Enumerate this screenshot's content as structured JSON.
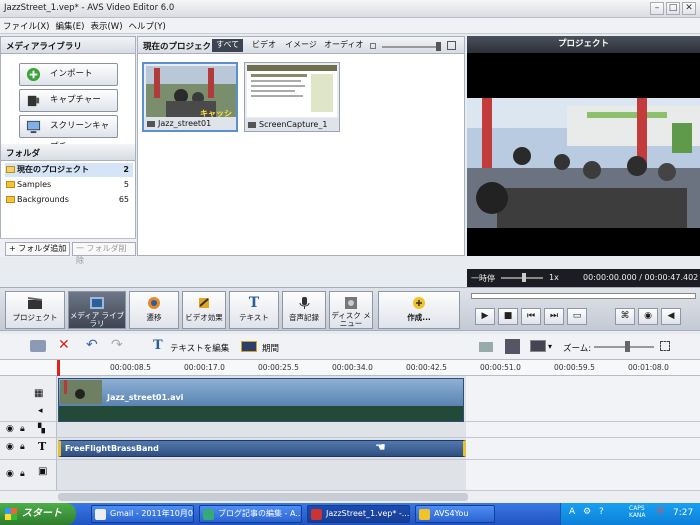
{
  "window": {
    "title": "JazzStreet_1.vep* - AVS Video Editor 6.0"
  },
  "menu": [
    "ファイル(X)",
    "編集(E)",
    "表示(W)",
    "ヘルプ(Y)"
  ],
  "library": {
    "header": "メディアライブラリ",
    "buttons": [
      "インポート",
      "キャプチャー",
      "スクリーンキャプチャ"
    ],
    "folder_header": "フォルダ",
    "folders": [
      {
        "name": "現在のプロジェクト",
        "count": "2"
      },
      {
        "name": "Samples",
        "count": "5"
      },
      {
        "name": "Backgrounds",
        "count": "65"
      }
    ],
    "add_folder": "+ フォルダ追加",
    "delete_folder": "一 フォルダ削除"
  },
  "project": {
    "header": "現在のプロジェクト",
    "tabs": [
      "すべて",
      "ビデオ",
      "イメージ",
      "オーディオ"
    ],
    "thumbs": [
      {
        "name": "Jazz_street01",
        "overlay": "キャッシング"
      },
      {
        "name": "ScreenCapture_1"
      }
    ]
  },
  "preview": {
    "header": "プロジェクト",
    "speed_label": "一時停",
    "speed_value": "1x",
    "time": "00:00:00.000 / 00:00:47.402"
  },
  "toolbar": [
    "プロジェクト",
    "メディア ライブラリ",
    "遷移",
    "ビデオ効果",
    "テキスト",
    "音声記録",
    "ディスク メニュー",
    "作成..."
  ],
  "timeline_tools": {
    "edit_text": "テキストを編集",
    "duration": "期間",
    "zoom": "ズーム:"
  },
  "ruler": [
    "00:00:08.5",
    "00:00:17.0",
    "00:00:25.5",
    "00:00:34.0",
    "00:00:42.5",
    "00:00:51.0",
    "00:00:59.5",
    "00:01:08.0"
  ],
  "tracks": {
    "video_clip": "Jazz_street01.avi",
    "text_clip": "FreeFlightBrassBand"
  },
  "taskbar": {
    "start": "スタート",
    "items": [
      "Gmail - 2011年10月0...",
      "ブログ記事の編集 - A...",
      "JazzStreet_1.vep* -...",
      "AVS4You"
    ],
    "clock": "7:27",
    "caps": "CAPS KANA"
  }
}
